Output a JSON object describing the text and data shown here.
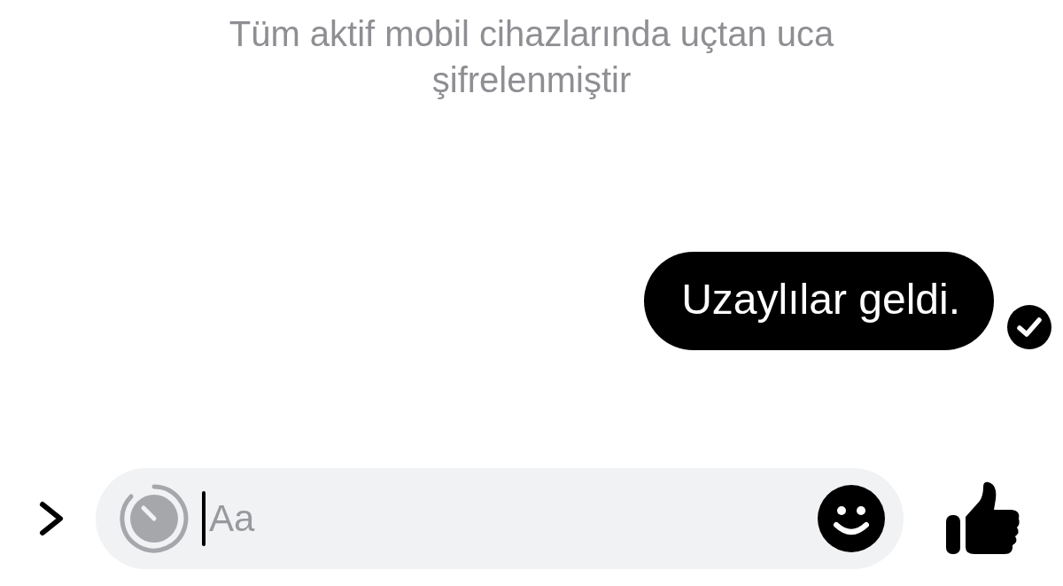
{
  "notice": "Tüm aktif mobil cihazlarında uçtan uca şifrelenmiştir",
  "messages": [
    {
      "text": "Uzaylılar geldi.",
      "delivered": true
    }
  ],
  "composer": {
    "placeholder": "Aa"
  }
}
